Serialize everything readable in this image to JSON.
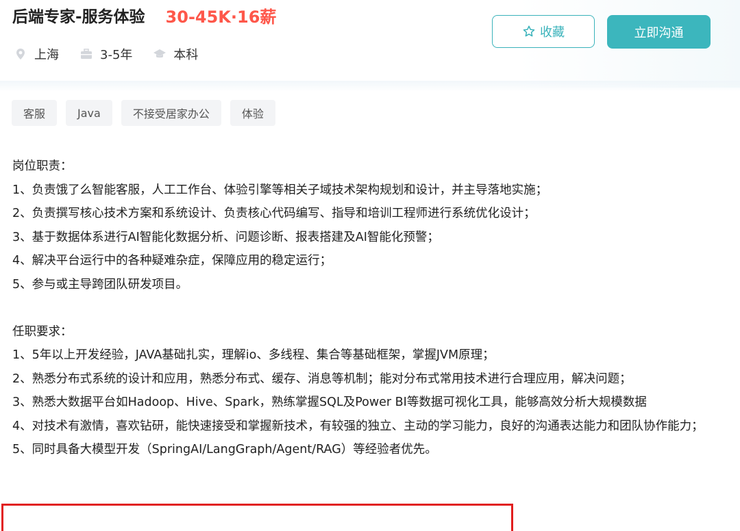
{
  "job": {
    "title": "后端专家-服务体验",
    "salary": "30-45K·16薪",
    "location": "上海",
    "experience": "3-5年",
    "education": "本科"
  },
  "actions": {
    "favorite_label": "收藏",
    "chat_label": "立即沟通"
  },
  "tags": [
    "客服",
    "Java",
    "不接受居家办公",
    "体验"
  ],
  "description": {
    "duties_heading": "岗位职责：",
    "duties": [
      "1、负责饿了么智能客服，人工工作台、体验引擎等相关子域技术架构规划和设计，并主导落地实施；",
      "2、负责撰写核心技术方案和系统设计、负责核心代码编写、指导和培训工程师进行系统优化设计；",
      "3、基于数据体系进行AI智能化数据分析、问题诊断、报表搭建及AI智能化预警；",
      "4、解决平台运行中的各种疑难杂症，保障应用的稳定运行；",
      "5、参与或主导跨团队研发项目。"
    ],
    "requirements_heading": "任职要求：",
    "requirements": [
      "1、5年以上开发经验，JAVA基础扎实，理解io、多线程、集合等基础框架，掌握JVM原理；",
      "2、熟悉分布式系统的设计和应用，熟悉分布式、缓存、消息等机制；能对分布式常用技术进行合理应用，解决问题；",
      "3、熟悉大数据平台如Hadoop、Hive、Spark，熟练掌握SQL及Power BI等数据可视化工具，能够高效分析大规模数据",
      "4、对技术有激情，喜欢钻研，能快速接受和掌握新技术，有较强的独立、主动的学习能力，良好的沟通表达能力和团队协作能力；",
      "5、同时具备大模型开发（SpringAI/LangGraph/Agent/RAG）等经验者优先。"
    ]
  },
  "colors": {
    "accent": "#3cb6bd",
    "salary": "#fe574a",
    "highlight_box": "#e11d1d"
  }
}
